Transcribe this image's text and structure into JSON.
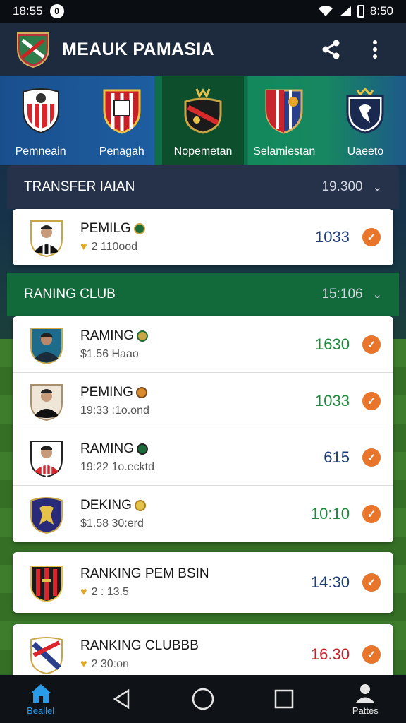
{
  "status_bar": {
    "time_left": "18:55",
    "notif_glyph": "0",
    "time_right": "8:50"
  },
  "app_bar": {
    "title": "MEAUK PAMASIA",
    "share_icon": "share-icon",
    "menu_icon": "more-vert-icon"
  },
  "club_tabs": [
    {
      "label": "Pemneain",
      "active": false
    },
    {
      "label": "Penagah",
      "active": false
    },
    {
      "label": "Nopemetan",
      "active": true
    },
    {
      "label": "Selamiestan",
      "active": false
    },
    {
      "label": "Uaeeto",
      "active": false
    }
  ],
  "sections": {
    "transfer": {
      "title": "TRANSFER IAIAN",
      "value": "19.300"
    },
    "transfer_row": {
      "name": "PEMILG",
      "sub": "2  110ood",
      "value": "1033"
    },
    "ranking": {
      "title": "RANING CLUB",
      "value": "15:106"
    }
  },
  "ranking_rows": [
    {
      "name": "RAMING",
      "sub": "$1.56 Haao",
      "value": "1630",
      "color": "#1c8a3a"
    },
    {
      "name": "PEMING",
      "sub": "19:33 :1o.ond",
      "value": "1033",
      "color": "#1c8a3a"
    },
    {
      "name": "RAMING",
      "sub": "19:22 1o.ecktd",
      "value": "615",
      "color": "#1d3f7c"
    },
    {
      "name": "DEKING",
      "sub": "$1.58 30:erd",
      "value": "10:10",
      "color": "#1c8a3a"
    }
  ],
  "standalone_rows": [
    {
      "name": "RANKING PEM BSIN",
      "sub": "2 : 13.5",
      "value": "14:30",
      "color": "#1d3f7c"
    },
    {
      "name": "RANKING CLUBBB",
      "sub": "2  30:on",
      "value": "16.30",
      "color": "#c9202a"
    }
  ],
  "nav": {
    "home_label": "Beallel",
    "profile_label": "Pattes"
  },
  "colors": {
    "app_bar": "#1e2a3e",
    "section_dark": "#26324a",
    "section_green": "#12693a",
    "accent": "#e8752a"
  }
}
